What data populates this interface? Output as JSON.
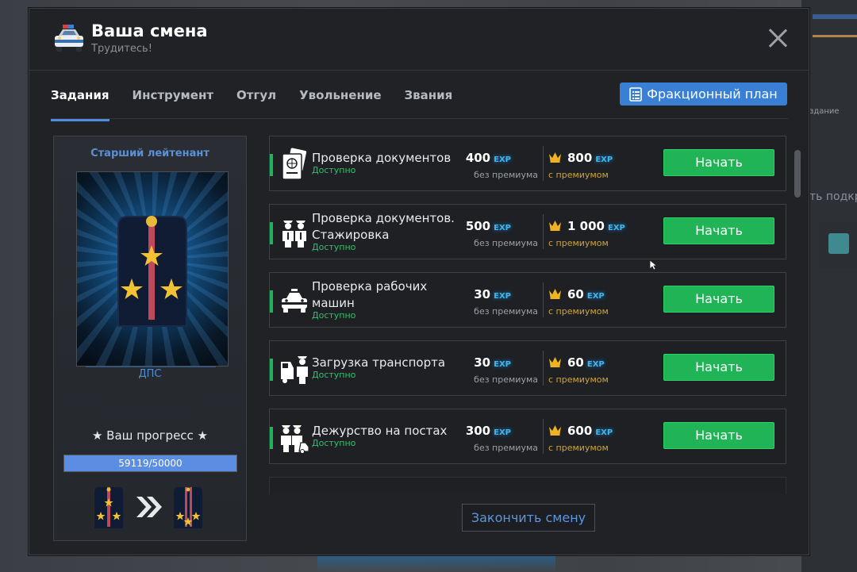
{
  "window": {
    "title": "Ваша смена",
    "subtitle": "Трудитесь!",
    "icon": "police-car-icon"
  },
  "tabs": [
    {
      "label": "Задания",
      "active": true
    },
    {
      "label": "Инструмент",
      "active": false
    },
    {
      "label": "Отгул",
      "active": false
    },
    {
      "label": "Увольнение",
      "active": false
    },
    {
      "label": "Звания",
      "active": false
    }
  ],
  "faction_button": {
    "label": "Фракционный план",
    "icon": "document-list-icon"
  },
  "rank": {
    "title": "Старший лейтенант",
    "department": "ДПС",
    "progress_label": "★ Ваш прогресс ★",
    "progress_text": "59119/50000",
    "progress_fraction": 1.0
  },
  "tasks": [
    {
      "name": "Проверка документов",
      "status": "Доступно",
      "base": "400",
      "premium": "800",
      "base_label": "без премиума",
      "premium_label": "с премиумом",
      "exp": "EXP",
      "button": "Начать",
      "icon": "passport-icon"
    },
    {
      "name": "Проверка документов. Стажировка",
      "status": "Доступно",
      "base": "500",
      "premium": "1 000",
      "base_label": "без премиума",
      "premium_label": "с премиумом",
      "exp": "EXP",
      "button": "Начать",
      "icon": "officers-icon"
    },
    {
      "name": "Проверка рабочих машин",
      "status": "Доступно",
      "base": "30",
      "premium": "60",
      "base_label": "без премиума",
      "premium_label": "с премиумом",
      "exp": "EXP",
      "button": "Начать",
      "icon": "police-car-icon"
    },
    {
      "name": "Загрузка транспорта",
      "status": "Доступно",
      "base": "30",
      "premium": "60",
      "base_label": "без премиума",
      "premium_label": "с премиумом",
      "exp": "EXP",
      "button": "Начать",
      "icon": "loading-officer-icon"
    },
    {
      "name": "Дежурство на постах",
      "status": "Доступно",
      "base": "300",
      "premium": "600",
      "base_label": "без премиума",
      "premium_label": "с премиумом",
      "exp": "EXP",
      "button": "Начать",
      "icon": "post-duty-icon"
    }
  ],
  "end_button": "Закончить смену",
  "background": {
    "right_text": "ть подкр",
    "right_small": "здание"
  },
  "colors": {
    "accent_blue": "#3a7fd6",
    "start_green": "#21b456",
    "status_green": "#2ec36a",
    "premium_gold": "#d2a537",
    "exp_cyan": "#3fb6ec"
  }
}
